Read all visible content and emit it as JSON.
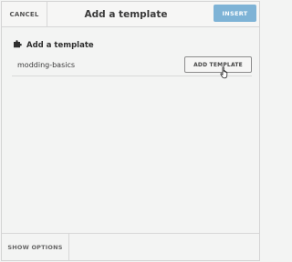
{
  "header": {
    "cancel_label": "CANCEL",
    "title": "Add a template",
    "insert_label": "INSERT"
  },
  "section": {
    "title": "Add a template",
    "icon": "puzzle-piece-icon"
  },
  "template_row": {
    "name": "modding-basics",
    "button_label": "ADD TEMPLATE"
  },
  "footer": {
    "show_options_label": "SHOW OPTIONS"
  },
  "colors": {
    "accent": "#7eb3d6",
    "background": "#f3f4f3",
    "border": "#d7d7d7"
  }
}
